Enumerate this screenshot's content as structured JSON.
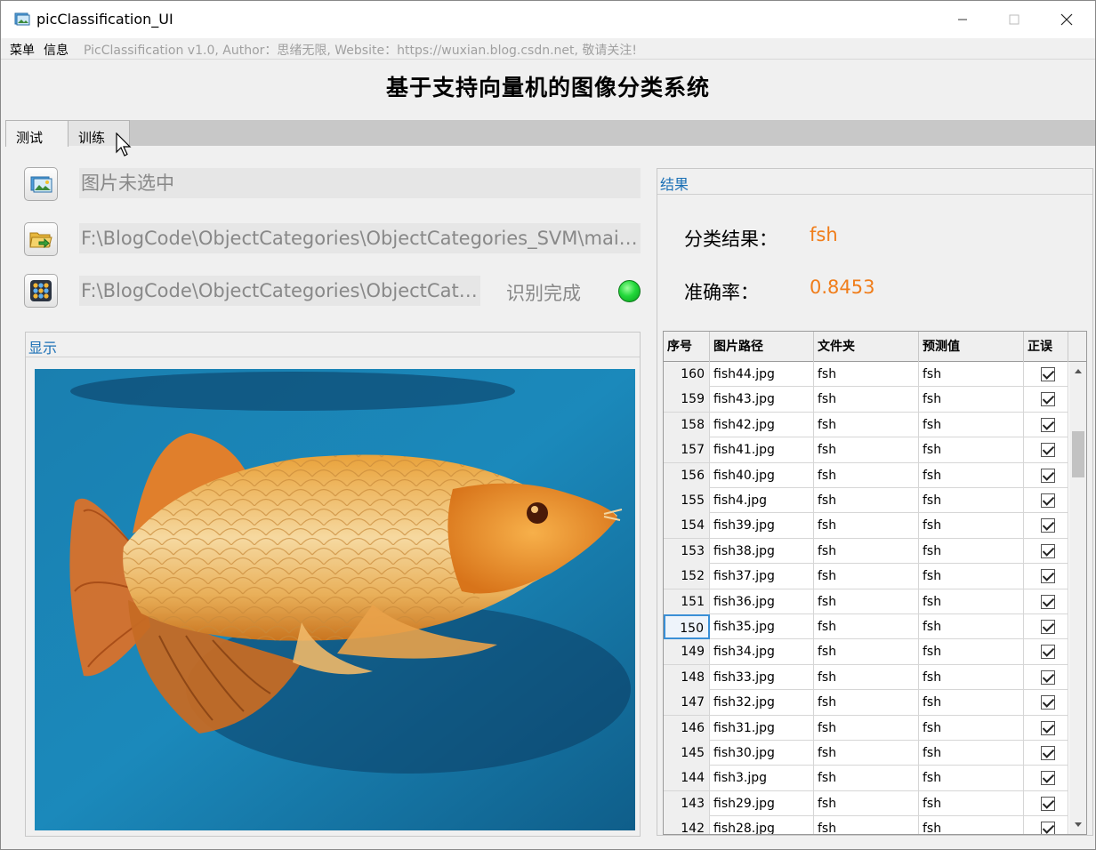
{
  "window": {
    "title": "picClassification_UI",
    "minimize_icon": "minimize-icon",
    "maximize_icon": "maximize-icon",
    "close_icon": "close-icon"
  },
  "menubar": {
    "items": [
      "菜单",
      "信息"
    ],
    "info": "PicClassification v1.0, Author：思绪无限, Website：https://wuxian.blog.csdn.net, 敬请关注!"
  },
  "header": {
    "title": "基于支持向量机的图像分类系统"
  },
  "tabs": [
    {
      "label": "测试",
      "active": true
    },
    {
      "label": "训练",
      "active": false
    }
  ],
  "controls": {
    "image_path": {
      "icon": "image-icon",
      "value": "图片未选中"
    },
    "folder_path": {
      "icon": "folder-open-icon",
      "value": "F:\\BlogCode\\ObjectCategories\\ObjectCategories_SVM\\main..."
    },
    "model_path": {
      "icon": "grid-icon",
      "value": "F:\\BlogCode\\ObjectCategories\\ObjectCate..."
    },
    "status": {
      "text": "识别完成",
      "led_color": "#22d83a"
    }
  },
  "display": {
    "label": "显示",
    "image_subject": "arowana-fish-photo"
  },
  "results": {
    "label": "结果",
    "class_label": "分类结果：",
    "class_value": "fsh",
    "accuracy_label": "准确率：",
    "accuracy_value": "0.8453",
    "value_color": "#f07d1a"
  },
  "table": {
    "columns": [
      "序号",
      "图片路径",
      "文件夹",
      "预测值",
      "正误"
    ],
    "selected_index": 150,
    "rows": [
      {
        "idx": "160",
        "path": "fish44.jpg",
        "folder": "fsh",
        "pred": "fsh",
        "ok": true
      },
      {
        "idx": "159",
        "path": "fish43.jpg",
        "folder": "fsh",
        "pred": "fsh",
        "ok": true
      },
      {
        "idx": "158",
        "path": "fish42.jpg",
        "folder": "fsh",
        "pred": "fsh",
        "ok": true
      },
      {
        "idx": "157",
        "path": "fish41.jpg",
        "folder": "fsh",
        "pred": "fsh",
        "ok": true
      },
      {
        "idx": "156",
        "path": "fish40.jpg",
        "folder": "fsh",
        "pred": "fsh",
        "ok": true
      },
      {
        "idx": "155",
        "path": "fish4.jpg",
        "folder": "fsh",
        "pred": "fsh",
        "ok": true
      },
      {
        "idx": "154",
        "path": "fish39.jpg",
        "folder": "fsh",
        "pred": "fsh",
        "ok": true
      },
      {
        "idx": "153",
        "path": "fish38.jpg",
        "folder": "fsh",
        "pred": "fsh",
        "ok": true
      },
      {
        "idx": "152",
        "path": "fish37.jpg",
        "folder": "fsh",
        "pred": "fsh",
        "ok": true
      },
      {
        "idx": "151",
        "path": "fish36.jpg",
        "folder": "fsh",
        "pred": "fsh",
        "ok": true
      },
      {
        "idx": "150",
        "path": "fish35.jpg",
        "folder": "fsh",
        "pred": "fsh",
        "ok": true
      },
      {
        "idx": "149",
        "path": "fish34.jpg",
        "folder": "fsh",
        "pred": "fsh",
        "ok": true
      },
      {
        "idx": "148",
        "path": "fish33.jpg",
        "folder": "fsh",
        "pred": "fsh",
        "ok": true
      },
      {
        "idx": "147",
        "path": "fish32.jpg",
        "folder": "fsh",
        "pred": "fsh",
        "ok": true
      },
      {
        "idx": "146",
        "path": "fish31.jpg",
        "folder": "fsh",
        "pred": "fsh",
        "ok": true
      },
      {
        "idx": "145",
        "path": "fish30.jpg",
        "folder": "fsh",
        "pred": "fsh",
        "ok": true
      },
      {
        "idx": "144",
        "path": "fish3.jpg",
        "folder": "fsh",
        "pred": "fsh",
        "ok": true
      },
      {
        "idx": "143",
        "path": "fish29.jpg",
        "folder": "fsh",
        "pred": "fsh",
        "ok": true
      },
      {
        "idx": "142",
        "path": "fish28.jpg",
        "folder": "fsh",
        "pred": "fsh",
        "ok": true
      }
    ]
  }
}
